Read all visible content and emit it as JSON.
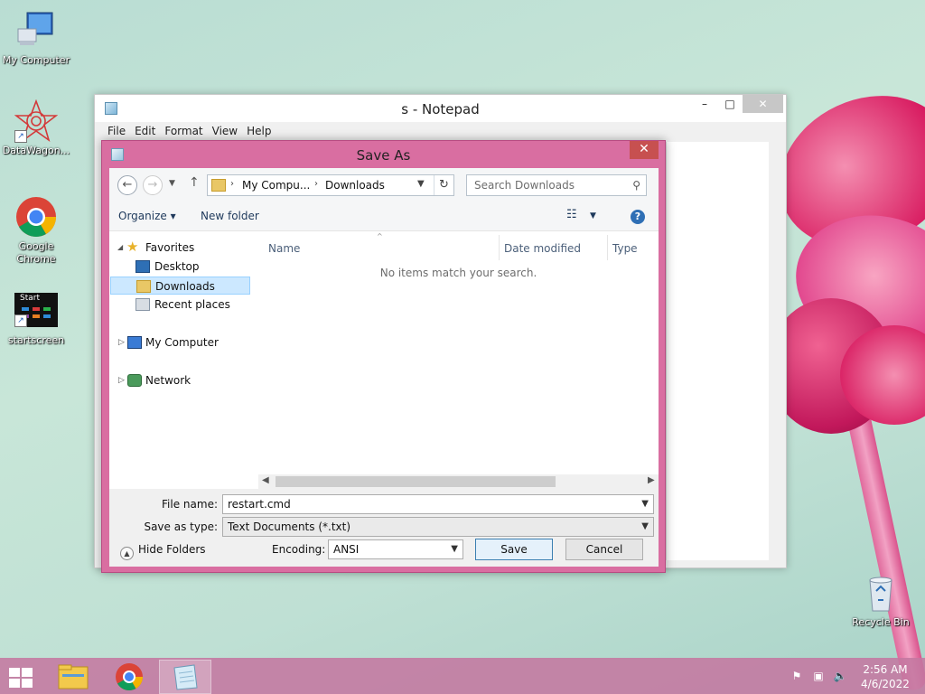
{
  "desktop": {
    "icons": [
      {
        "label": "My Computer",
        "icon": "computer-icon"
      },
      {
        "label": "DataWagon...",
        "icon": "datawagon-icon"
      },
      {
        "label": "Google Chrome",
        "icon": "chrome-icon"
      },
      {
        "label": "startscreen",
        "icon": "startscreen-icon",
        "thumb_text": "Start"
      },
      {
        "label": "Recycle Bin",
        "icon": "recycle-bin-icon"
      }
    ]
  },
  "notepad": {
    "title": "s - Notepad",
    "minimize": "–",
    "maximize": "□",
    "close": "✕",
    "menu": [
      "File",
      "Edit",
      "Format",
      "View",
      "Help"
    ]
  },
  "save_dialog": {
    "title": "Save As",
    "close": "✕",
    "address": {
      "crumbs": [
        "My Compu...",
        "Downloads"
      ],
      "separator": "›"
    },
    "search_placeholder": "Search Downloads",
    "toolbar": {
      "organize": "Organize ▾",
      "new_folder": "New folder",
      "help": "?"
    },
    "nav": {
      "favorites": "Favorites",
      "desktop": "Desktop",
      "downloads": "Downloads",
      "recent": "Recent places",
      "my_computer": "My Computer",
      "network": "Network"
    },
    "columns": {
      "name": "Name",
      "date": "Date modified",
      "type": "Type"
    },
    "empty_message": "No items match your search.",
    "file_name_label": "File name:",
    "file_name_value": "restart.cmd",
    "save_as_type_label": "Save as type:",
    "save_as_type_value": "Text Documents (*.txt)",
    "encoding_label": "Encoding:",
    "encoding_value": "ANSI",
    "save_button": "Save",
    "cancel_button": "Cancel",
    "hide_folders": "Hide Folders"
  },
  "taskbar": {
    "time": "2:56 AM",
    "date": "4/6/2022"
  },
  "colors": {
    "dialog_frame": "#d96ea1",
    "taskbar": "#c478a0",
    "close_red": "#c75050",
    "selection": "#cce8ff"
  }
}
